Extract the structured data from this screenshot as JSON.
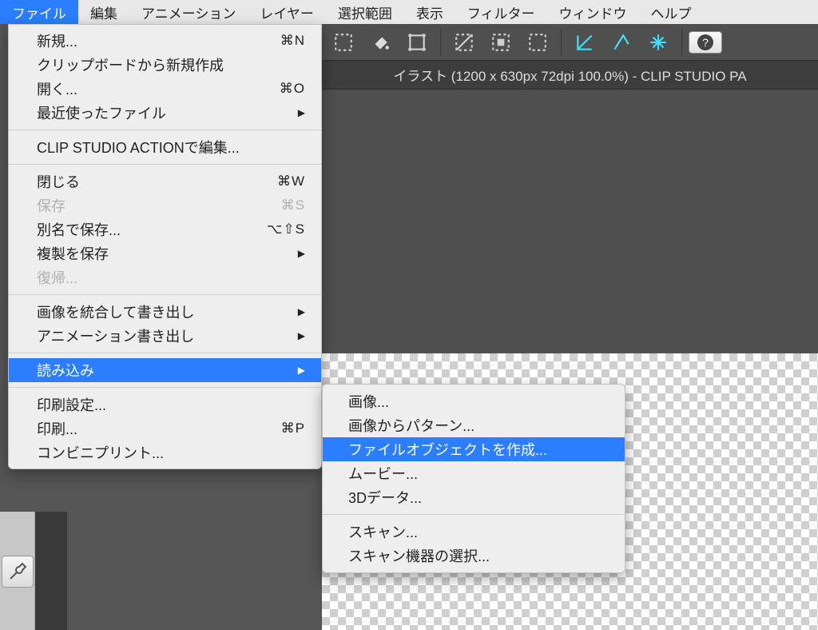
{
  "menubar": [
    "ファイル",
    "編集",
    "アニメーション",
    "レイヤー",
    "選択範囲",
    "表示",
    "フィルター",
    "ウィンドウ",
    "ヘルプ"
  ],
  "titlebar": "イラスト (1200 x 630px 72dpi 100.0%)  - CLIP STUDIO PA",
  "file_menu": [
    {
      "label": "新規...",
      "shortcut": "⌘N"
    },
    {
      "label": "クリップボードから新規作成"
    },
    {
      "label": "開く...",
      "shortcut": "⌘O"
    },
    {
      "label": "最近使ったファイル",
      "arrow": true
    },
    {
      "sep": true
    },
    {
      "label": "CLIP STUDIO ACTIONで編集..."
    },
    {
      "sep": true
    },
    {
      "label": "閉じる",
      "shortcut": "⌘W"
    },
    {
      "label": "保存",
      "shortcut": "⌘S",
      "disabled": true
    },
    {
      "label": "別名で保存...",
      "shortcut": "⌥⇧S"
    },
    {
      "label": "複製を保存",
      "arrow": true
    },
    {
      "label": "復帰...",
      "disabled": true
    },
    {
      "sep": true
    },
    {
      "label": "画像を統合して書き出し",
      "arrow": true
    },
    {
      "label": "アニメーション書き出し",
      "arrow": true
    },
    {
      "sep": true
    },
    {
      "label": "読み込み",
      "arrow": true,
      "highlight": true
    },
    {
      "sep": true
    },
    {
      "label": "印刷設定..."
    },
    {
      "label": "印刷...",
      "shortcut": "⌘P"
    },
    {
      "label": "コンビニプリント..."
    }
  ],
  "import_submenu": [
    {
      "label": "画像..."
    },
    {
      "label": "画像からパターン..."
    },
    {
      "label": "ファイルオブジェクトを作成...",
      "highlight": true
    },
    {
      "label": "ムービー..."
    },
    {
      "label": "3Dデータ..."
    },
    {
      "sep": true
    },
    {
      "label": "スキャン..."
    },
    {
      "label": "スキャン機器の選択..."
    }
  ]
}
